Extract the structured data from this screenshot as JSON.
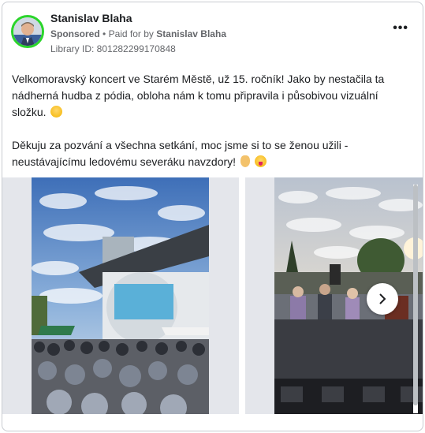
{
  "post": {
    "author": "Stanislav Blaha",
    "sponsored_label": "Sponsored",
    "paid_prefix": "Paid for by",
    "payer": "Stanislav Blaha",
    "library_id": "Library ID: 801282299170848",
    "paragraph1": "Velkomoravský koncert ve Starém Městě, už 15. ročník! Jako by nestačila ta nádherná hudba z pódia, obloha nám k tomu připravila i působivou vizuální složku.",
    "paragraph2": "Děkuju za pozvání a všechna setkání, moc jsme si to se ženou užili - neustávajícímu ledovému severáku navzdory!"
  },
  "icons": {
    "more": "more-options-icon",
    "next": "chevron-right-icon",
    "emoji1": "smiling-face-emoji",
    "emoji2": "thumbs-up-emoji",
    "emoji3": "tongue-face-emoji"
  },
  "colors": {
    "online_ring": "#2bd52b",
    "meta_text": "#65676b",
    "body_text": "#1c1e21",
    "border": "#c9ccd1"
  }
}
